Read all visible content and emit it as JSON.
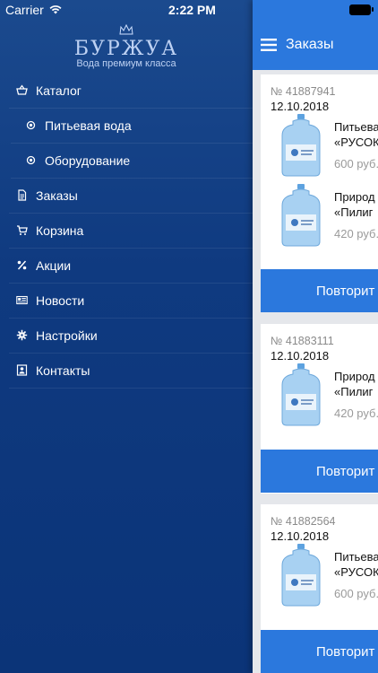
{
  "status_bar": {
    "carrier": "Carrier",
    "time": "2:22 PM"
  },
  "drawer": {
    "logo_title": "БУРЖУА",
    "logo_subtitle": "Вода премиум класса",
    "items": [
      {
        "label": "Каталог",
        "icon": "basket-icon"
      },
      {
        "label": "Питьевая вода",
        "icon": "radio-dot-icon"
      },
      {
        "label": "Оборудование",
        "icon": "radio-dot-icon"
      },
      {
        "label": "Заказы",
        "icon": "document-icon"
      },
      {
        "label": "Корзина",
        "icon": "cart-icon"
      },
      {
        "label": "Акции",
        "icon": "percent-icon"
      },
      {
        "label": "Новости",
        "icon": "news-icon"
      },
      {
        "label": "Настройки",
        "icon": "gear-icon"
      },
      {
        "label": "Контакты",
        "icon": "contact-icon"
      }
    ]
  },
  "main": {
    "title": "Заказы",
    "orders": [
      {
        "number": "№ 41887941",
        "date": "12.10.2018",
        "items": [
          {
            "name_line1": "Питьева",
            "name_line2": "«РУСОК",
            "price": "600 руб."
          },
          {
            "name_line1": "Природ",
            "name_line2": "«Пилиг",
            "price": "420 руб."
          }
        ],
        "repeat_label": "Повторит"
      },
      {
        "number": "№ 41883111",
        "date": "12.10.2018",
        "items": [
          {
            "name_line1": "Природ",
            "name_line2": "«Пилиг",
            "price": "420 руб."
          }
        ],
        "repeat_label": "Повторит"
      },
      {
        "number": "№ 41882564",
        "date": "12.10.2018",
        "items": [
          {
            "name_line1": "Питьева",
            "name_line2": "«РУСОК",
            "price": "600 руб."
          }
        ],
        "repeat_label": "Повторит"
      }
    ]
  },
  "colors": {
    "drawer_bg": "#0f3a80",
    "accent": "#2b78dd",
    "content_bg": "#e5e7eb"
  }
}
